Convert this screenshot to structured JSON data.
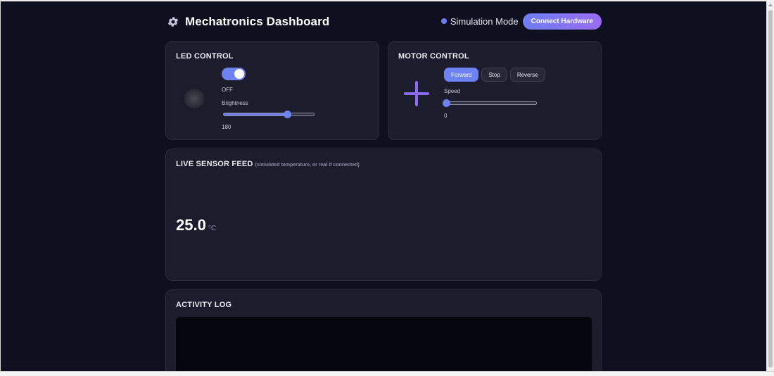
{
  "header": {
    "title": "Mechatronics Dashboard",
    "icon": "gear-icon",
    "mode_label": "Simulation Mode",
    "connect_label": "Connect Hardware"
  },
  "led": {
    "title": "LED CONTROL",
    "toggle_on": true,
    "state_label": "OFF",
    "brightness_label": "Brightness",
    "brightness_value": "180",
    "brightness_fraction": 0.706
  },
  "motor": {
    "title": "MOTOR CONTROL",
    "buttons": [
      "Forward",
      "Stop",
      "Reverse"
    ],
    "active_button": "Forward",
    "speed_label": "Speed",
    "speed_value": "0",
    "speed_fraction": 0
  },
  "sensor": {
    "title": "LIVE SENSOR FEED",
    "subtitle": "(simulated temperature, or real if connected)",
    "value": "25.0",
    "unit": "°C"
  },
  "log": {
    "title": "ACTIVITY LOG"
  },
  "colors": {
    "background": "#0e1020",
    "card": "#1b1c2c",
    "accent": "#6f82f4",
    "accent_gradient_end": "#9a6cf2"
  }
}
